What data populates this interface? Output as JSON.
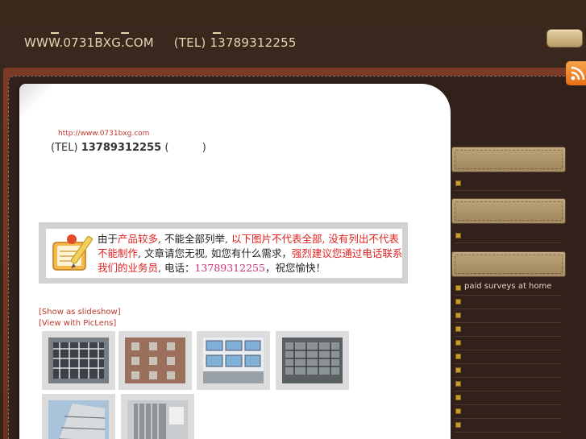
{
  "header": {
    "site_name": "WWW.0731BXG.COM",
    "tel_label": "(TEL) 13789312255"
  },
  "content": {
    "site_link": "http://www.0731bxg.com",
    "tel_prefix": "(TEL) ",
    "tel_number": "13789312255",
    "tel_suffix": " (          )"
  },
  "banner": {
    "p1": "由于",
    "p2": "产品较多",
    "p3": ", 不能全部列举, ",
    "p4": "以下图片不代表全部, 没有列出不代表不能制作",
    "p5": ", 文章请您无视, 如您有什么需求，",
    "p6": "强烈建议您通过电话联系我们的业务员",
    "p7": ", 电话：",
    "p8": "13789312255",
    "p9": "，祝您愉快！"
  },
  "gallery": {
    "slideshow_link": "[Show as slideshow]",
    "piclens_link": "[View with PicLens]"
  },
  "sidebar": {
    "items": [
      {
        "label": ""
      },
      {
        "label": ""
      },
      {
        "label": "paid surveys at home"
      },
      {
        "label": ""
      },
      {
        "label": ""
      },
      {
        "label": ""
      },
      {
        "label": ""
      },
      {
        "label": ""
      },
      {
        "label": ""
      },
      {
        "label": ""
      },
      {
        "label": ""
      },
      {
        "label": ""
      },
      {
        "label": ""
      }
    ]
  },
  "colors": {
    "background": "#3a281d",
    "frame": "#7b3a25",
    "link": "#c0392b",
    "accent_red": "#e02020"
  }
}
